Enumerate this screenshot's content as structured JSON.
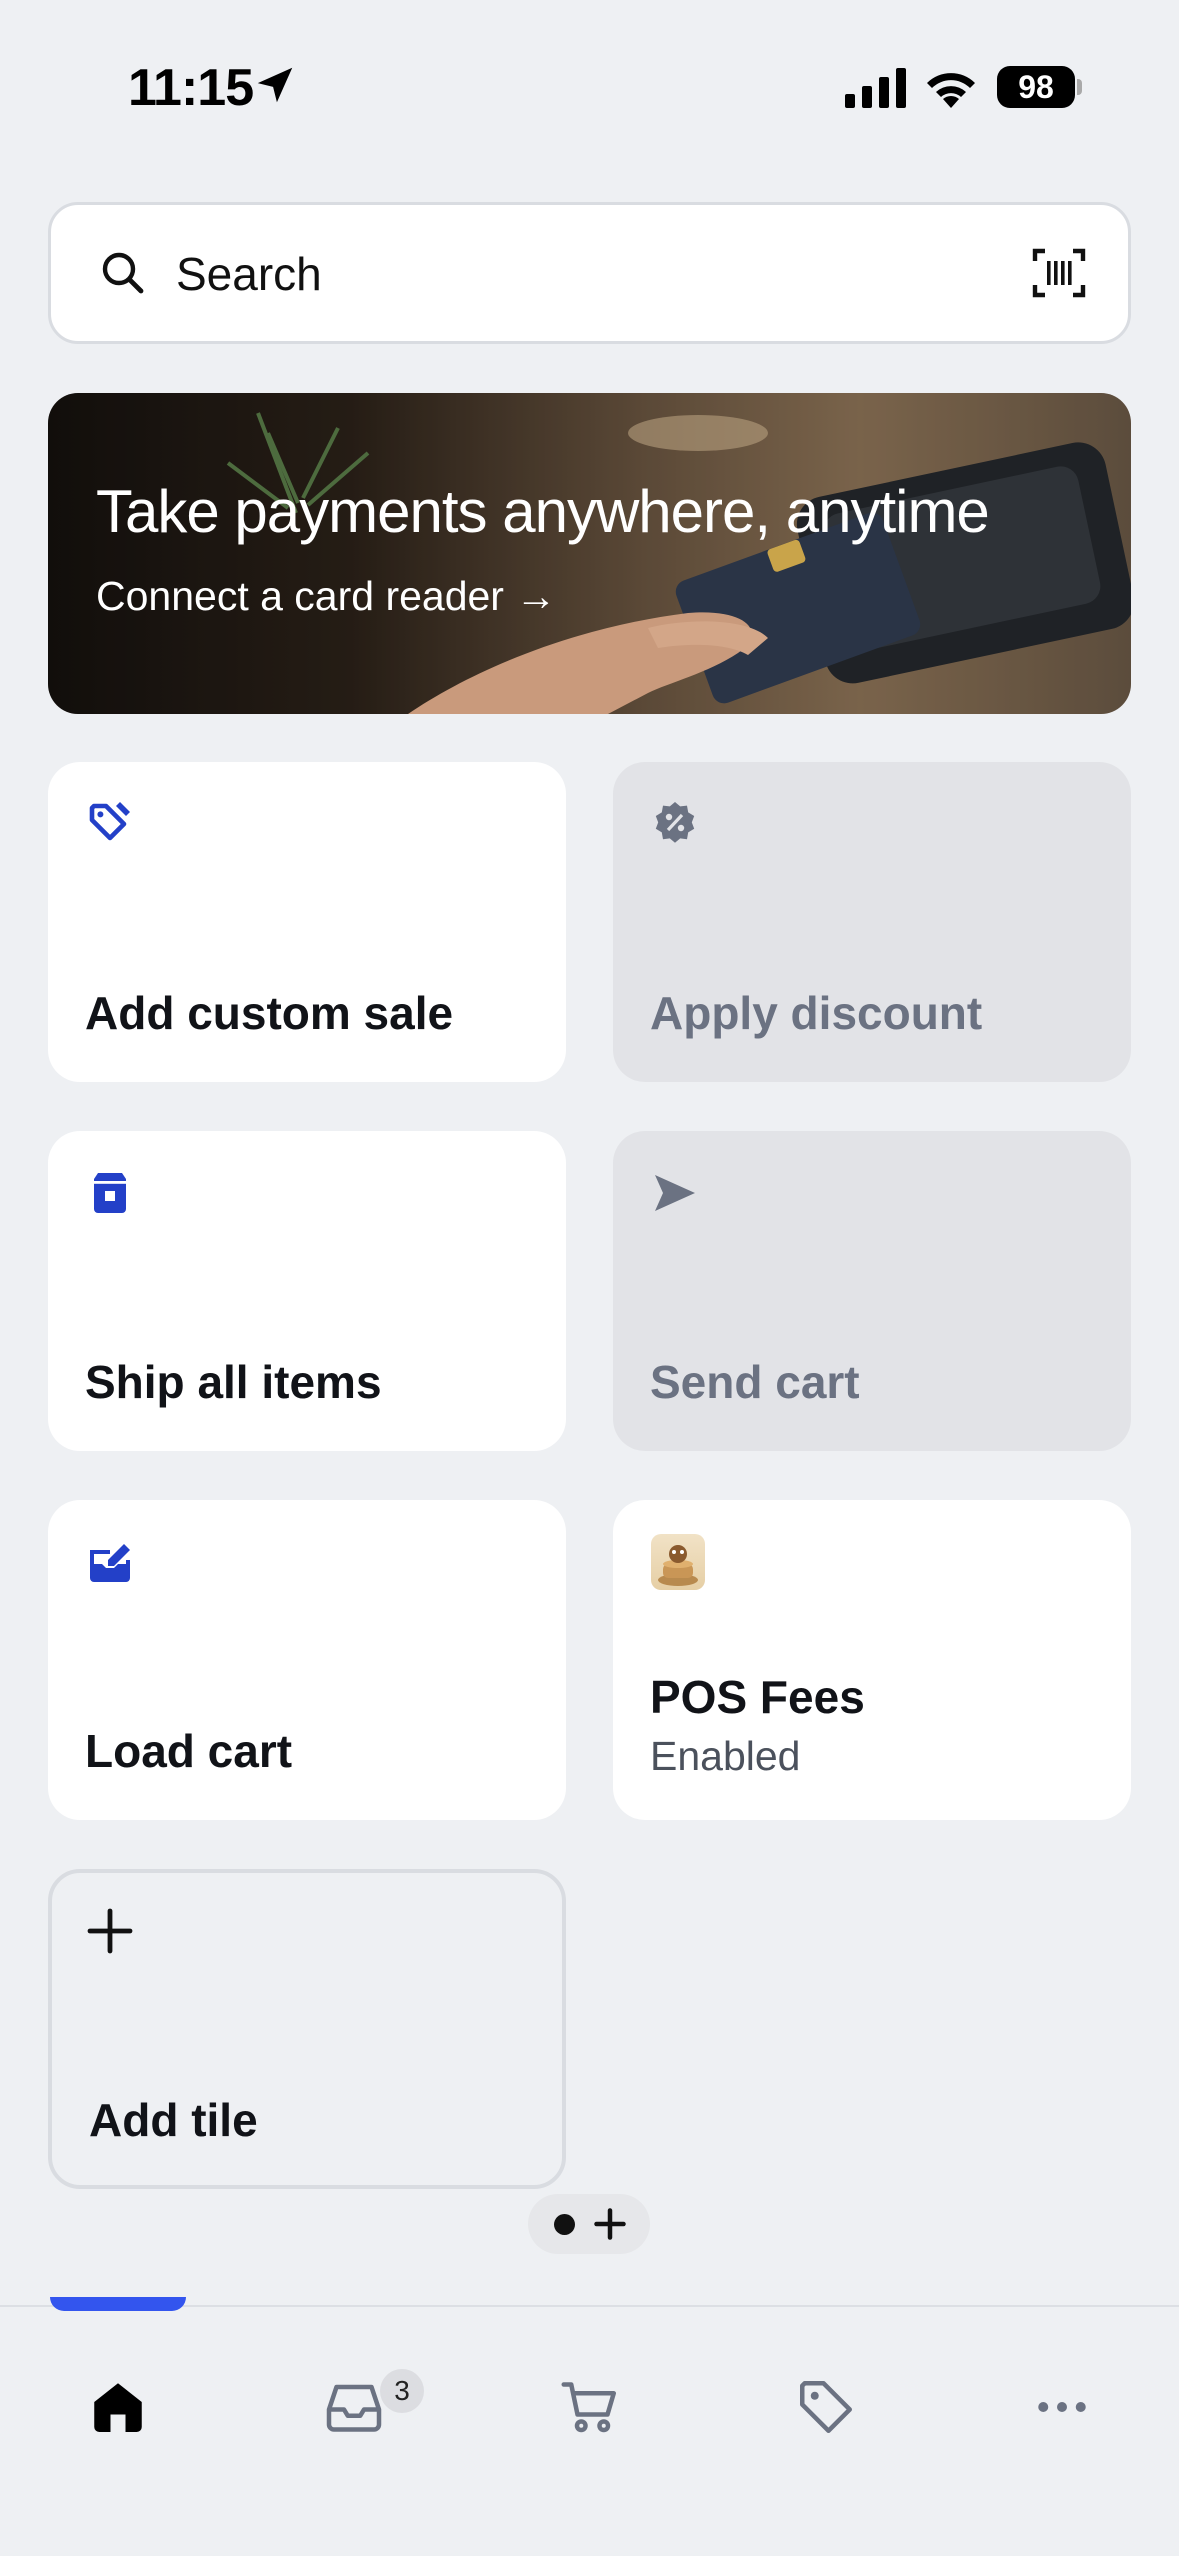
{
  "status_bar": {
    "time": "11:15",
    "battery": "98"
  },
  "search": {
    "placeholder": "Search"
  },
  "banner": {
    "title": "Take payments anywhere, anytime",
    "link": "Connect a card reader →"
  },
  "tiles": [
    {
      "label": "Add custom sale",
      "icon": "tag-edit-icon",
      "enabled": true
    },
    {
      "label": "Apply discount",
      "icon": "discount-badge-icon",
      "enabled": false
    },
    {
      "label": "Ship all items",
      "icon": "box-icon",
      "enabled": true
    },
    {
      "label": "Send cart",
      "icon": "send-icon",
      "enabled": false
    },
    {
      "label": "Load cart",
      "icon": "inbox-edit-icon",
      "enabled": true
    },
    {
      "label": "POS Fees",
      "sublabel": "Enabled",
      "icon": "app-thumbnail",
      "enabled": true
    },
    {
      "label": "Add tile",
      "icon": "plus-icon",
      "enabled": true
    }
  ],
  "tab_bar": {
    "items": [
      {
        "name": "home",
        "icon": "home-icon",
        "active": true
      },
      {
        "name": "orders",
        "icon": "inbox-icon",
        "badge": "3"
      },
      {
        "name": "cart",
        "icon": "cart-icon"
      },
      {
        "name": "products",
        "icon": "tag-icon"
      },
      {
        "name": "more",
        "icon": "more-icon"
      }
    ]
  },
  "colors": {
    "accent": "#2340c8",
    "active_tab": "#3355ee",
    "disabled_text": "#6b7282"
  }
}
